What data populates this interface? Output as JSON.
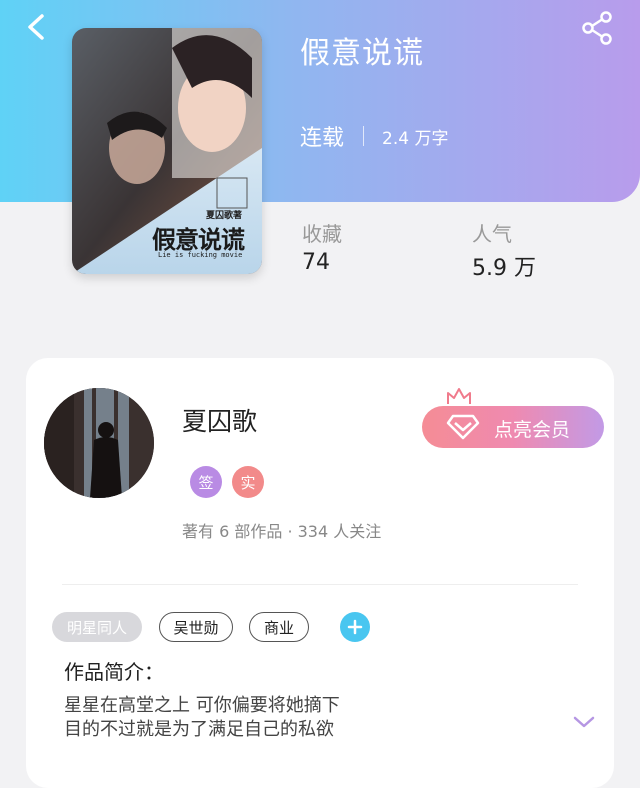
{
  "header": {
    "title": "假意说谎",
    "status": "连载",
    "word_count": "2.4 万字",
    "back_icon": "chevron-left-icon",
    "share_icon": "share-icon",
    "gradient": [
      "#5fd2f6",
      "#b89cec"
    ]
  },
  "cover": {
    "title_text": "假意说谎",
    "subtitle_text": "Lie is fucking movie",
    "author_tag": "夏囚歌著"
  },
  "stats": [
    {
      "label": "收藏",
      "value": "74"
    },
    {
      "label": "人气",
      "value": "5.9 万"
    }
  ],
  "author": {
    "name": "夏囚歌",
    "badges": [
      {
        "label": "签",
        "color": "#b98be4"
      },
      {
        "label": "实",
        "color": "#f28a8a"
      }
    ],
    "meta": "著有 6 部作品 · 334 人关注"
  },
  "vip_button": {
    "label": "点亮会员",
    "icon": "diamond-icon",
    "crown_icon": "crown-icon"
  },
  "tags": [
    {
      "label": "明星同人",
      "style": "filled"
    },
    {
      "label": "吴世勋",
      "style": "outline"
    },
    {
      "label": "商业",
      "style": "outline"
    }
  ],
  "intro": {
    "heading": "作品简介：",
    "line1": "星星在高堂之上 可你偏要将她摘下",
    "line2": "目的不过就是为了满足自己的私欲"
  }
}
